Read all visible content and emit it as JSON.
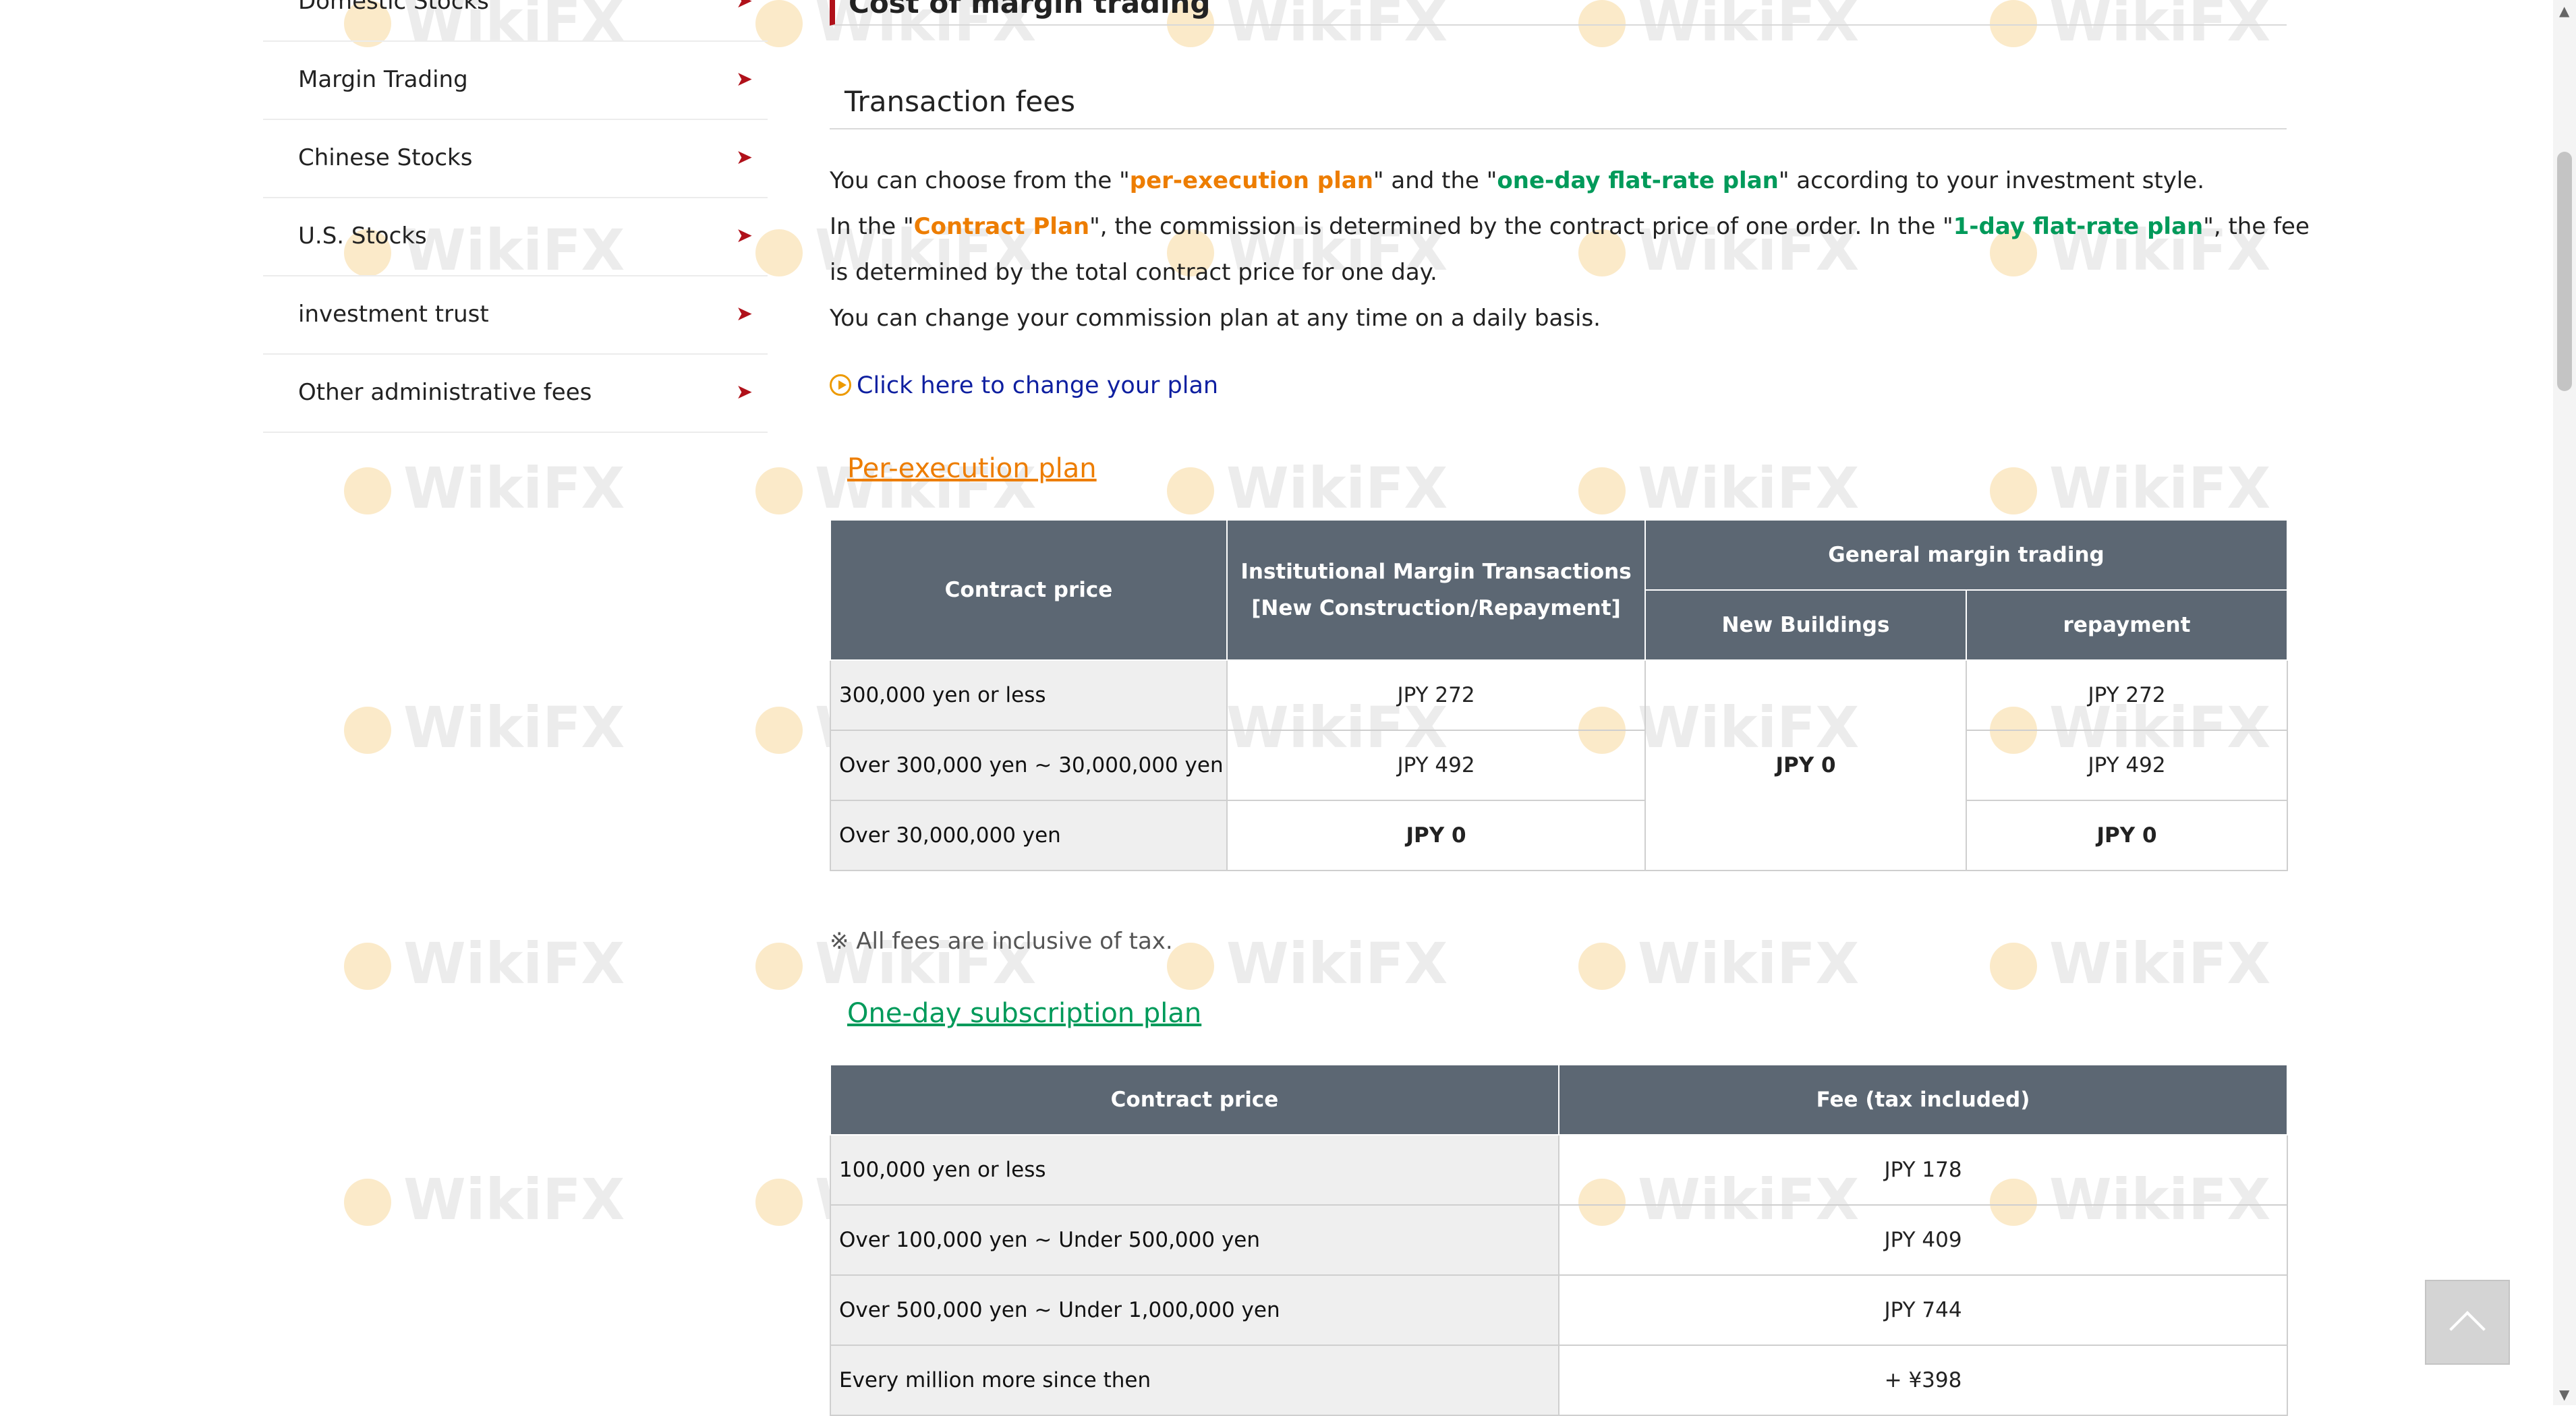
{
  "sidebar": {
    "items": [
      {
        "label": "Domestic Stocks"
      },
      {
        "label": "Margin Trading"
      },
      {
        "label": "Chinese Stocks"
      },
      {
        "label": "U.S. Stocks"
      },
      {
        "label": "investment trust"
      },
      {
        "label": "Other administrative fees"
      }
    ],
    "arrow_glyph": "➤",
    "arrow_color": "#b0111a"
  },
  "main": {
    "section_title": "Cost of margin trading",
    "subsection_title": "Transaction fees",
    "intro": {
      "l1_a": "You can choose from the \"",
      "l1_plan1": "per-execution plan",
      "l1_b": "\" and the \"",
      "l1_plan2": "one-day flat-rate plan",
      "l1_c": "\" according to your investment style.",
      "l2_a": "In the \"",
      "l2_plan1": "Contract Plan",
      "l2_b": "\", the commission is determined by the contract price of one order. In the \"",
      "l2_plan2": "1-day flat-rate plan",
      "l2_c": "\", the fee",
      "l3": "is determined by the total contract price for one day.",
      "l4": "You can change your commission plan at any time on a daily basis."
    },
    "change_plan_link": "Click here to change your plan",
    "per_execution": {
      "title": "Per-execution plan",
      "headers": {
        "contract_price": "Contract price",
        "institutional_l1": "Institutional Margin Transactions",
        "institutional_l2": "[New Construction/Repayment]",
        "general": "General margin trading",
        "new_buildings": "New Buildings",
        "repayment": "repayment"
      },
      "rows": [
        {
          "label": "300,000 yen or less",
          "institutional": "JPY 272",
          "repayment": "JPY 272"
        },
        {
          "label": "Over 300,000 yen ~ 30,000,000 yen",
          "institutional": "JPY 492",
          "repayment": "JPY 492"
        },
        {
          "label": "Over 30,000,000 yen",
          "institutional": "JPY 0",
          "repayment": "JPY 0"
        }
      ],
      "new_buildings_merged": "JPY 0"
    },
    "tax_note": "※ All fees are inclusive of tax.",
    "one_day": {
      "title": "One-day subscription plan",
      "headers": {
        "contract_price": "Contract price",
        "fee": "Fee (tax included)"
      },
      "rows": [
        {
          "label": "100,000 yen or less",
          "fee": "JPY 178"
        },
        {
          "label": "Over 100,000 yen ~ Under 500,000 yen",
          "fee": "JPY 409"
        },
        {
          "label": "Over 500,000 yen ~ Under 1,000,000 yen",
          "fee": "JPY 744"
        },
        {
          "label": "Every million more since then",
          "fee": "+ ¥398"
        }
      ]
    }
  },
  "watermark": "WikiFX",
  "colors": {
    "accent_red": "#b0111a",
    "orange": "#ed7d00",
    "green": "#009a5a",
    "table_header": "#5c6773",
    "row_label_bg": "#efefef",
    "link_blue": "#0e1fa0"
  }
}
